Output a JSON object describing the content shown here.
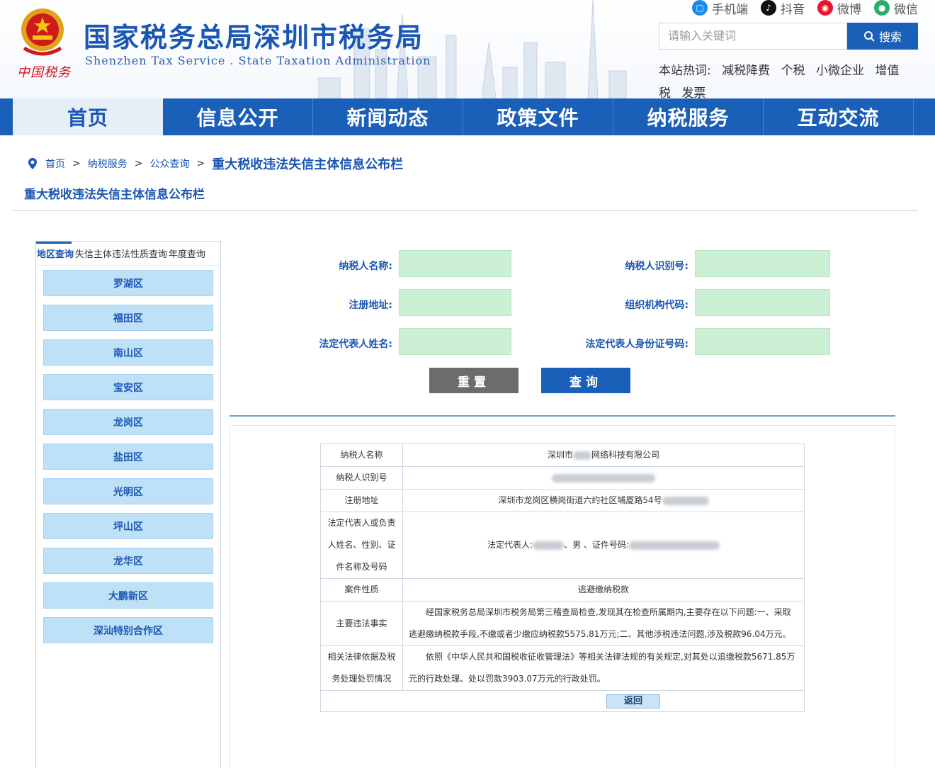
{
  "header": {
    "site_title": "国家税务总局深圳市税务局",
    "site_subtitle": "Shenzhen Tax Service . State Taxation Administration",
    "brand_mark": "中国税务",
    "social": [
      {
        "label": "手机端",
        "icon": "mobile-icon",
        "color": "#1a8ce8"
      },
      {
        "label": "抖音",
        "icon": "douyin-icon",
        "color": "#111111"
      },
      {
        "label": "微博",
        "icon": "weibo-icon",
        "color": "#e6162d"
      },
      {
        "label": "微信",
        "icon": "wechat-icon",
        "color": "#2aae67"
      }
    ],
    "search": {
      "placeholder": "请输入关键词",
      "button_label": "搜索"
    },
    "hot_words": {
      "label": "本站热词:",
      "items": [
        "减税降费",
        "个税",
        "小微企业",
        "增值税",
        "发票"
      ]
    }
  },
  "nav": {
    "items": [
      "首页",
      "信息公开",
      "新闻动态",
      "政策文件",
      "纳税服务",
      "互动交流"
    ],
    "active_index": 0
  },
  "breadcrumb": {
    "items": [
      "首页",
      "纳税服务",
      "公众查询"
    ],
    "separator": ">",
    "current": "重大税收违法失信主体信息公布栏"
  },
  "page_title": "重大税收违法失信主体信息公布栏",
  "left_panel": {
    "tabs": [
      "地区查询",
      "失信主体违法性质查询",
      "年度查询"
    ],
    "active_tab": 0,
    "districts": [
      "罗湖区",
      "福田区",
      "南山区",
      "宝安区",
      "龙岗区",
      "盐田区",
      "光明区",
      "坪山区",
      "龙华区",
      "大鹏新区",
      "深汕特别合作区"
    ]
  },
  "form": {
    "fields": [
      {
        "label": "纳税人名称:",
        "value": ""
      },
      {
        "label": "纳税人识别号:",
        "value": ""
      },
      {
        "label": "注册地址:",
        "value": ""
      },
      {
        "label": "组织机构代码:",
        "value": ""
      },
      {
        "label": "法定代表人姓名:",
        "value": ""
      },
      {
        "label": "法定代表人身份证号码:",
        "value": ""
      }
    ],
    "reset_label": "重置",
    "query_label": "查询"
  },
  "result": {
    "rows": [
      {
        "key": "纳税人名称",
        "value_prefix": "深圳市",
        "value_suffix": "网络科技有限公司"
      },
      {
        "key": "纳税人识别号",
        "value_prefix": "",
        "value_suffix": ""
      },
      {
        "key": "注册地址",
        "value_prefix": "深圳市龙岗区横岗街道六约社区埔厦路54号",
        "value_suffix": ""
      },
      {
        "key": "法定代表人或负责人姓名、性别、证件名称及号码",
        "value_prefix": "法定代表人:",
        "value_mid": "、男 、证件号码:",
        "value_suffix": ""
      },
      {
        "key": "案件性质",
        "value_prefix": "逃避缴纳税款",
        "value_suffix": ""
      },
      {
        "key": "主要违法事实",
        "value_prefix": "经国家税务总局深圳市税务局第三稽查局检查,发现其在检查所属期内,主要存在以下问题:一、采取逃避缴纳税款手段,不缴或者少缴应纳税款5575.81万元;二、其他涉税违法问题,涉及税款96.04万元。",
        "value_suffix": ""
      },
      {
        "key": "相关法律依据及税务处理处罚情况",
        "value_prefix": "依照《中华人民共和国税收征收管理法》等相关法律法规的有关规定,对其处以追缴税款5671.85万元的行政处理、处以罚款3903.07万元的行政处罚。",
        "value_suffix": ""
      }
    ],
    "back_label": "返回"
  }
}
